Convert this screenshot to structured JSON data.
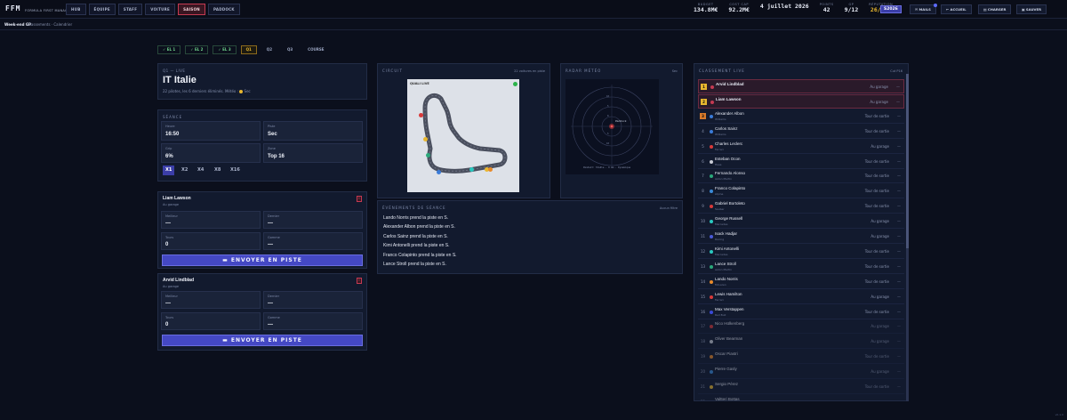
{
  "brand": {
    "logo": "FFM",
    "subtitle": "FORMULA FIRST MANAGER"
  },
  "nav": [
    "HUB",
    "ÉQUIPE",
    "STAFF",
    "VOITURE",
    "SAISON",
    "PADDOCK"
  ],
  "nav_active": "SAISON",
  "stats": [
    {
      "label": "BUDGET",
      "value": "134.8M€"
    },
    {
      "label": "COST CAP",
      "value": "92.2M€"
    },
    {
      "label": "",
      "value": "4 juillet 2026"
    },
    {
      "label": "POINTS",
      "value": "42"
    },
    {
      "label": "GP",
      "value": "9/12"
    },
    {
      "label": "RÉPUTATION",
      "value": "26/100"
    }
  ],
  "season_badge": "S2026",
  "top_buttons": {
    "mail": "MAILS",
    "home": "ACCUEIL",
    "load": "CHARGER",
    "save": "SAUVER"
  },
  "subbar": {
    "title": "Week-end GP",
    "links": "Classements · Calendrier"
  },
  "tabs": [
    "✓ EL 1",
    "✓ EL 2",
    "✓ EL 3",
    "Q1",
    "Q2",
    "Q3",
    "COURSE"
  ],
  "gp": {
    "sub": "Q1 — LIVE",
    "name": "IT Italie",
    "info": "22 pilotes, les 6 derniers éliminés. Météo :",
    "weather": "Sec"
  },
  "seance": {
    "title": "SÉANCE",
    "cells": [
      {
        "label": "Heure",
        "value": "16:50"
      },
      {
        "label": "Piste",
        "value": "Sec"
      },
      {
        "label": "Grip",
        "value": "6%"
      },
      {
        "label": "Zone",
        "value": "Top 16"
      }
    ],
    "speeds": [
      "X1",
      "X2",
      "X4",
      "X8",
      "X16"
    ]
  },
  "drivers": [
    {
      "name": "Liam Lawson",
      "state": "Au garage",
      "f1_label": "Meilleur",
      "f1": "—",
      "f2_label": "Dernier",
      "f2": "—",
      "f3_label": "Tours",
      "f3": "0",
      "f4_label": "Gomme",
      "f4": "—",
      "button": "ENVOYER EN PISTE",
      "flag": "!"
    },
    {
      "name": "Arvid Lindblad",
      "state": "Au garage",
      "f1_label": "Meilleur",
      "f1": "—",
      "f2_label": "Dernier",
      "f2": "—",
      "f3_label": "Tours",
      "f3": "0",
      "f4_label": "Gomme",
      "f4": "—",
      "button": "ENVOYER EN PISTE",
      "flag": "!"
    }
  ],
  "circuit": {
    "title": "CIRCUIT",
    "count": "22 voitures en piste",
    "map_label": "QUALI LIVE"
  },
  "radar": {
    "title": "RADAR MÉTÉO",
    "state": "Sec",
    "center": "Paddock",
    "rings": [
      "10",
      "5",
      "0",
      "5",
      "10"
    ],
    "caption": "Pendant: Stable · 0 mm · Dynamique"
  },
  "events": {
    "title": "ÉVÉNEMENTS DE SÉANCE",
    "filter": "Aucun filtre",
    "items": [
      "Lando Norris prend la piste en S.",
      "Alexander Albon prend la piste en S.",
      "Carlos Sainz prend la piste en S.",
      "Kimi Antonelli prend la piste en S.",
      "Franco Colapinto prend la piste en S.",
      "Lance Stroll prend la piste en S."
    ]
  },
  "standings": {
    "title": "CLASSEMENT LIVE",
    "cut": "Cut P16",
    "rows": [
      {
        "pos": "1",
        "name": "Arvid Lindblad",
        "team": "",
        "status": "Au garage",
        "color": "#c53a52",
        "hl": true
      },
      {
        "pos": "2",
        "name": "Liam Lawson",
        "team": "",
        "status": "Au garage",
        "color": "#c53a52",
        "hl": true
      },
      {
        "pos": "3",
        "name": "Alexander Albon",
        "team": "Williams",
        "status": "Tour de sortie",
        "color": "#3a7bd8"
      },
      {
        "pos": "4",
        "name": "Carlos Sainz",
        "team": "Williams",
        "status": "Tour de sortie",
        "color": "#3a7bd8"
      },
      {
        "pos": "5",
        "name": "Charles Leclerc",
        "team": "Ferrari",
        "status": "Au garage",
        "color": "#d83a3a"
      },
      {
        "pos": "6",
        "name": "Esteban Ocon",
        "team": "Haas",
        "status": "Tour de sortie",
        "color": "#c9ccd6"
      },
      {
        "pos": "7",
        "name": "Fernando Alonso",
        "team": "Aston Martin",
        "status": "Tour de sortie",
        "color": "#2aa87a"
      },
      {
        "pos": "8",
        "name": "Franco Colapinto",
        "team": "Alpine",
        "status": "Tour de sortie",
        "color": "#3a8ad8"
      },
      {
        "pos": "9",
        "name": "Gabriel Bortoleto",
        "team": "Sauber",
        "status": "Tour de sortie",
        "color": "#d83a3a"
      },
      {
        "pos": "10",
        "name": "George Russell",
        "team": "Mercedes",
        "status": "Au garage",
        "color": "#2ac9c0"
      },
      {
        "pos": "11",
        "name": "Isack Hadjar",
        "team": "Racing",
        "status": "Au garage",
        "color": "#4a5ad8"
      },
      {
        "pos": "12",
        "name": "Kimi Antonelli",
        "team": "Mercedes",
        "status": "Tour de sortie",
        "color": "#2ac9c0"
      },
      {
        "pos": "13",
        "name": "Lance Stroll",
        "team": "Aston Martin",
        "status": "Tour de sortie",
        "color": "#2aa87a"
      },
      {
        "pos": "14",
        "name": "Lando Norris",
        "team": "McLaren",
        "status": "Tour de sortie",
        "color": "#e88a2a"
      },
      {
        "pos": "15",
        "name": "Lewis Hamilton",
        "team": "Ferrari",
        "status": "Au garage",
        "color": "#d83a3a"
      },
      {
        "pos": "16",
        "name": "Max Verstappen",
        "team": "Red Bull",
        "status": "Tour de sortie",
        "color": "#3a4ad8"
      },
      {
        "pos": "17",
        "name": "Nico Hülkenberg",
        "team": "",
        "status": "Au garage",
        "color": "#d83a3a",
        "dim": true
      },
      {
        "pos": "18",
        "name": "Oliver Bearman",
        "team": "",
        "status": "Au garage",
        "color": "#c9ccd6",
        "dim": true
      },
      {
        "pos": "19",
        "name": "Oscar Piastri",
        "team": "",
        "status": "Tour de sortie",
        "color": "#e88a2a",
        "dim": true
      },
      {
        "pos": "20",
        "name": "Pierre Gasly",
        "team": "",
        "status": "Au garage",
        "color": "#3a8ad8",
        "dim": true
      },
      {
        "pos": "21",
        "name": "Sergio Pérez",
        "team": "",
        "status": "Tour de sortie",
        "color": "#e8b72f",
        "dim": true
      },
      {
        "pos": "22",
        "name": "Valtteri Bottas",
        "team": "",
        "status": "",
        "color": "#e8b72f",
        "dim": true
      }
    ]
  },
  "version": "v0.1.0"
}
